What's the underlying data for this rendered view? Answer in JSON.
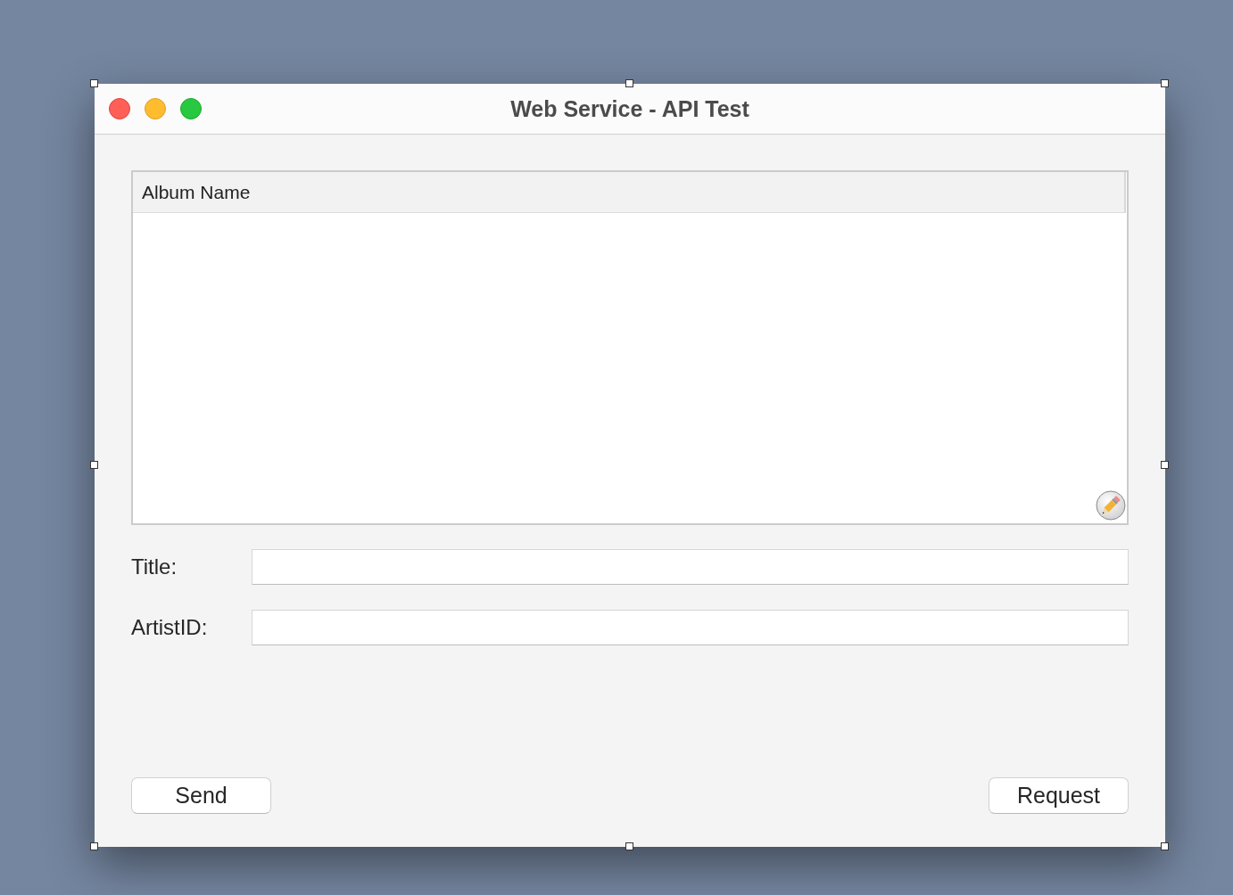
{
  "window": {
    "title": "Web Service - API Test"
  },
  "table": {
    "columns": [
      "Album Name"
    ]
  },
  "fields": [
    {
      "label": "Title:"
    },
    {
      "label": "ArtistID:"
    }
  ],
  "buttons": [
    "Send",
    "Request"
  ]
}
